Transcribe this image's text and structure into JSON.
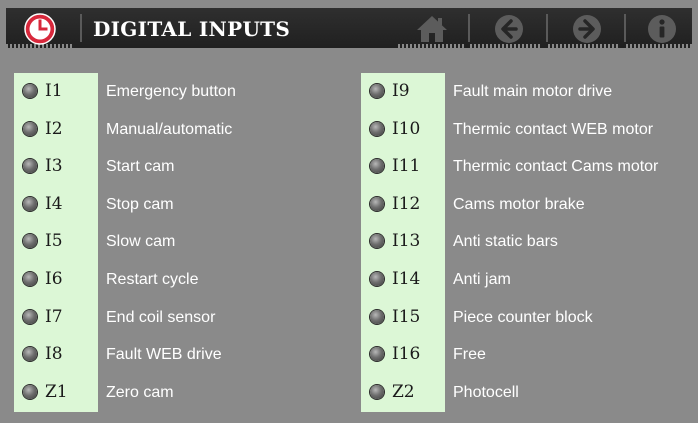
{
  "header": {
    "title": "DIGITAL INPUTS",
    "buttons": [
      "clock",
      "home",
      "back",
      "forward",
      "info"
    ]
  },
  "colors": {
    "background": "#8a8a8a",
    "header_bar": "#262626",
    "code_strip": "#dcf7d6",
    "clock_red": "#d8283c",
    "icon_gray": "#5c5c5c",
    "led_off": "#6e6e6e"
  },
  "inputs_left": [
    {
      "code": "I1",
      "label": "Emergency button",
      "state": "off"
    },
    {
      "code": "I2",
      "label": "Manual/automatic",
      "state": "off"
    },
    {
      "code": "I3",
      "label": "Start cam",
      "state": "off"
    },
    {
      "code": "I4",
      "label": "Stop cam",
      "state": "off"
    },
    {
      "code": "I5",
      "label": "Slow cam",
      "state": "off"
    },
    {
      "code": "I6",
      "label": "Restart cycle",
      "state": "off"
    },
    {
      "code": "I7",
      "label": "End coil sensor",
      "state": "off"
    },
    {
      "code": "I8",
      "label": "Fault WEB drive",
      "state": "off"
    },
    {
      "code": "Z1",
      "label": "Zero cam",
      "state": "off"
    }
  ],
  "inputs_right": [
    {
      "code": "I9",
      "label": "Fault main motor drive",
      "state": "off"
    },
    {
      "code": "I10",
      "label": "Thermic contact WEB motor",
      "state": "off"
    },
    {
      "code": "I11",
      "label": "Thermic contact Cams motor",
      "state": "off"
    },
    {
      "code": "I12",
      "label": "Cams motor brake",
      "state": "off"
    },
    {
      "code": "I13",
      "label": "Anti static bars",
      "state": "off"
    },
    {
      "code": "I14",
      "label": "Anti jam",
      "state": "off"
    },
    {
      "code": "I15",
      "label": "Piece counter block",
      "state": "off"
    },
    {
      "code": "I16",
      "label": "Free",
      "state": "off"
    },
    {
      "code": "Z2",
      "label": "Photocell",
      "state": "off"
    }
  ]
}
